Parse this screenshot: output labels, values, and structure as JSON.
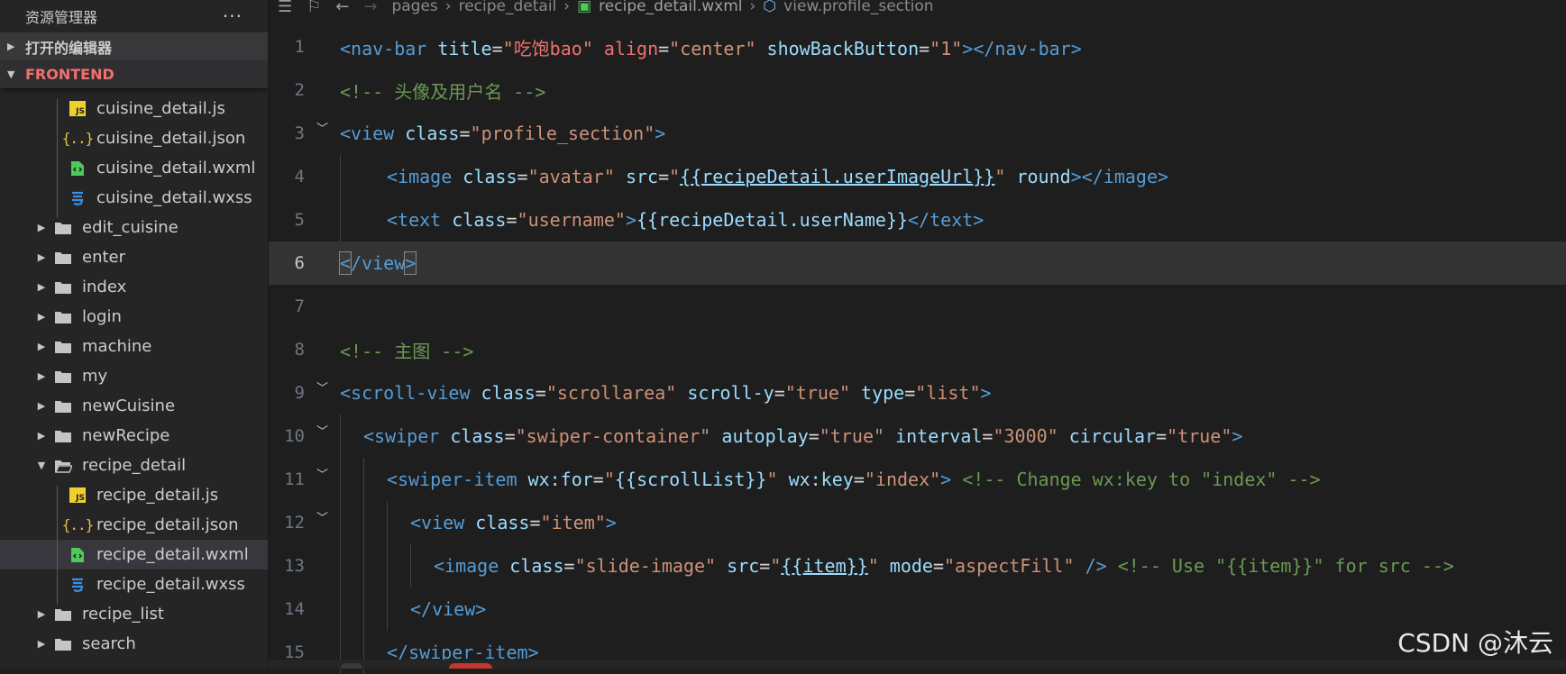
{
  "sidebar": {
    "title": "资源管理器",
    "more": "···",
    "section_open_editors": "打开的编辑器",
    "section_frontend": "FRONTEND",
    "files": [
      {
        "type": "file",
        "icon": "js",
        "name": "cuisine_detail.js"
      },
      {
        "type": "file",
        "icon": "json",
        "name": "cuisine_detail.json"
      },
      {
        "type": "file",
        "icon": "wxml",
        "name": "cuisine_detail.wxml"
      },
      {
        "type": "file",
        "icon": "wxss",
        "name": "cuisine_detail.wxss"
      },
      {
        "type": "folder",
        "name": "edit_cuisine"
      },
      {
        "type": "folder",
        "name": "enter"
      },
      {
        "type": "folder",
        "name": "index"
      },
      {
        "type": "folder",
        "name": "login"
      },
      {
        "type": "folder",
        "name": "machine"
      },
      {
        "type": "folder",
        "name": "my"
      },
      {
        "type": "folder",
        "name": "newCuisine"
      },
      {
        "type": "folder",
        "name": "newRecipe"
      },
      {
        "type": "folder-open",
        "name": "recipe_detail"
      },
      {
        "type": "file",
        "icon": "js",
        "name": "recipe_detail.js"
      },
      {
        "type": "file",
        "icon": "json",
        "name": "recipe_detail.json"
      },
      {
        "type": "file",
        "icon": "wxml",
        "name": "recipe_detail.wxml",
        "selected": true
      },
      {
        "type": "file",
        "icon": "wxss",
        "name": "recipe_detail.wxss"
      },
      {
        "type": "folder",
        "name": "recipe_list"
      },
      {
        "type": "folder",
        "name": "search"
      }
    ]
  },
  "breadcrumb": {
    "items": [
      "pages",
      "recipe_detail",
      "recipe_detail.wxml",
      "view.profile_section"
    ]
  },
  "editor": {
    "line_numbers": [
      "1",
      "2",
      "3",
      "4",
      "5",
      "6",
      "7",
      "8",
      "9",
      "10",
      "11",
      "12",
      "13",
      "14",
      "15"
    ],
    "current_line": 6
  },
  "watermark": "CSDN @沐云",
  "colors": {
    "tag": "#569cd6",
    "attr": "#9cdcfe",
    "string": "#ce9178",
    "comment": "#6a9955",
    "background": "#1e1e1e",
    "sidebar": "#252526"
  }
}
